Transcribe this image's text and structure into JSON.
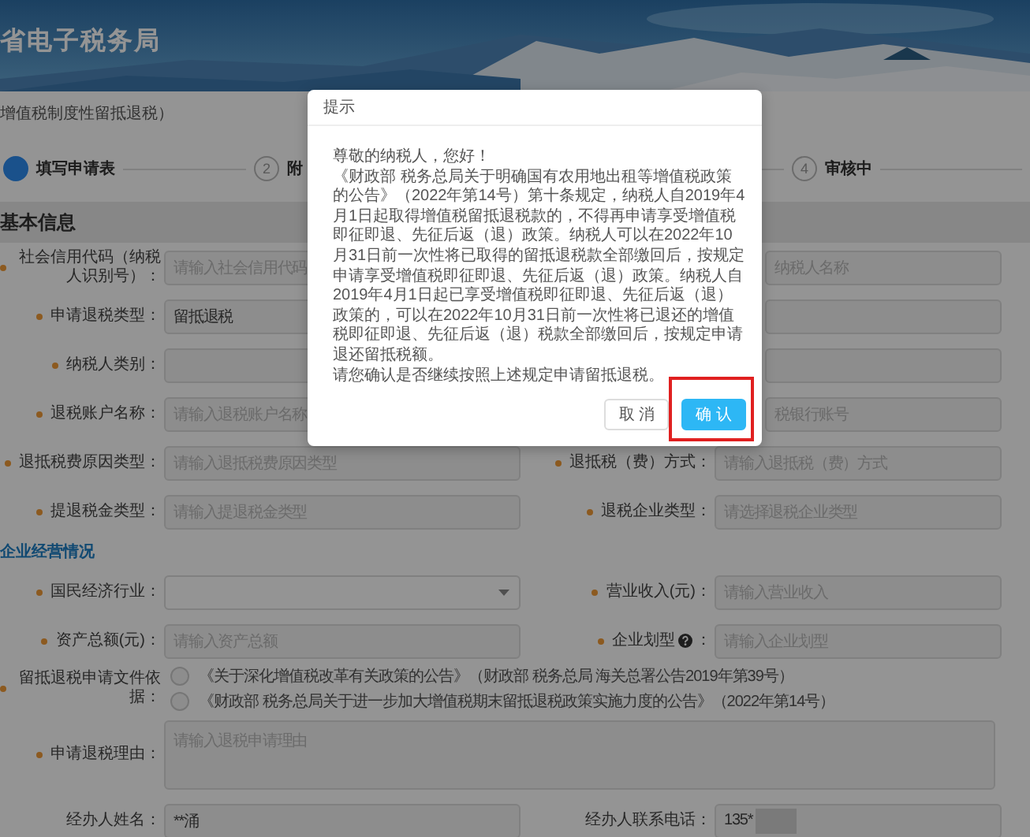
{
  "header": {
    "title": "省电子税务局"
  },
  "subtitle": "增值税制度性留抵退税）",
  "steps": [
    {
      "label": "填写申请表",
      "selected": true
    },
    {
      "number": "2",
      "label": "附",
      "selected": false
    },
    {
      "number": "4",
      "label": "审核中",
      "selected": false
    }
  ],
  "sections": [
    {
      "kind": "band",
      "title": "基本信息",
      "rows": [
        {
          "left": {
            "label": "社会信用代码（纳税人识别号）：",
            "required": true,
            "kind": "text",
            "placeholder": "请输入社会信用代码"
          },
          "right": {
            "kind": "text",
            "placeholder": "纳税人名称"
          }
        },
        {
          "left": {
            "label": "申请退税类型：",
            "required": true,
            "kind": "text",
            "value": "留抵退税"
          },
          "right": {
            "kind": "text"
          }
        },
        {
          "left": {
            "label": "纳税人类别：",
            "required": true,
            "kind": "text"
          },
          "right": {
            "kind": "text"
          }
        },
        {
          "left": {
            "label": "退税账户名称：",
            "required": true,
            "kind": "text",
            "placeholder": "请输入退税账户名称"
          },
          "right": {
            "kind": "text",
            "placeholder": "税银行账号"
          }
        },
        {
          "left": {
            "label": "退抵税费原因类型：",
            "required": true,
            "kind": "text",
            "placeholder": "请输入退抵税费原因类型"
          },
          "right": {
            "label": "退抵税（费）方式：",
            "required": true,
            "kind": "text",
            "placeholder": "请输入退抵税（费）方式"
          }
        },
        {
          "left": {
            "label": "提退税金类型：",
            "required": true,
            "kind": "text",
            "placeholder": "请输入提退税金类型"
          },
          "right": {
            "label": "退税企业类型：",
            "required": true,
            "kind": "text",
            "placeholder": "请选择退税企业类型"
          }
        }
      ]
    },
    {
      "kind": "heading",
      "title": "企业经营情况",
      "rows": [
        {
          "left": {
            "label": "国民经济行业：",
            "required": true,
            "kind": "select"
          },
          "right": {
            "label": "营业收入(元)：",
            "required": true,
            "kind": "text",
            "placeholder": "请输入营业收入"
          }
        },
        {
          "left": {
            "label": "资产总额(元)：",
            "required": true,
            "kind": "text",
            "placeholder": "请输入资产总额"
          },
          "right": {
            "label": "企业划型",
            "help": true,
            "suffix": "：",
            "required": true,
            "kind": "text",
            "placeholder": "请输入企业划型"
          }
        },
        {
          "left": {
            "label": "留抵退税申请文件依据：",
            "required": true,
            "kind": "radios",
            "options": [
              {
                "label": "《关于深化增值税改革有关政策的公告》（财政部 税务总局 海关总署公告2019年第39号）",
                "selected": false
              },
              {
                "label": "《财政部 税务总局关于进一步加大增值税期末留抵退税政策实施力度的公告》（2022年第14号）",
                "selected": false
              }
            ]
          }
        },
        {
          "left": {
            "label": "申请退税理由：",
            "required": true,
            "kind": "textarea",
            "placeholder": "请输入退税申请理由"
          }
        },
        {
          "left": {
            "label": "经办人姓名：",
            "required": false,
            "kind": "text",
            "value": "**涌"
          },
          "right": {
            "label": "经办人联系电话：",
            "required": false,
            "kind": "text",
            "value": "135*",
            "masked": true
          }
        }
      ]
    }
  ],
  "dialog": {
    "title": "提示",
    "paragraphs": [
      "尊敬的纳税人，您好！",
      "《财政部 税务总局关于明确国有农用地出租等增值税政策的公告》（2022年第14号）第十条规定，纳税人自2019年4月1日起取得增值税留抵退税款的，不得再申请享受增值税即征即退、先征后返（退）政策。纳税人可以在2022年10月31日前一次性将已取得的留抵退税款全部缴回后，按规定申请享受增值税即征即退、先征后返（退）政策。纳税人自2019年4月1日起已享受增值税即征即退、先征后返（退）政策的，可以在2022年10月31日前一次性将已退还的增值税即征即退、先征后返（退）税款全部缴回后，按规定申请退还留抵税额。",
      "请您确认是否继续按照上述规定申请留抵退税。"
    ],
    "buttons": [
      {
        "kind": "secondary",
        "label": "取 消",
        "highlighted": false
      },
      {
        "kind": "primary",
        "label": "确 认",
        "highlighted": true
      }
    ]
  }
}
